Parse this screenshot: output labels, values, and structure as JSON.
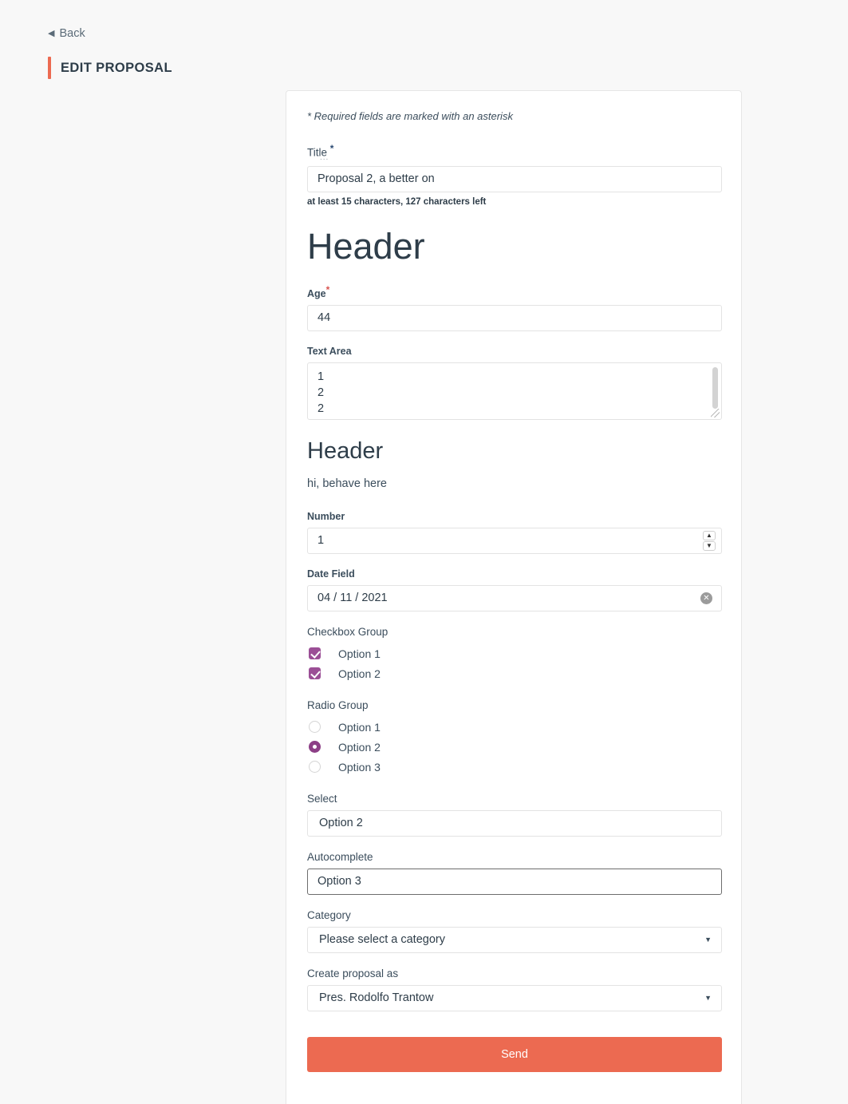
{
  "nav": {
    "back_label": "Back",
    "back_icon": "chevron-left-icon",
    "page_title": "EDIT PROPOSAL",
    "accent_color": "#ec6a51"
  },
  "form": {
    "required_note": "* Required fields are marked with an asterisk",
    "title_field": {
      "label": "Title",
      "asterisk": "*",
      "tooltip_dots": "...",
      "value": "Proposal 2, a better on",
      "helper": "at least 15 characters, 127 characters left"
    },
    "header_1": "Header",
    "age_field": {
      "label": "Age",
      "asterisk": "*",
      "value": "44"
    },
    "textarea_field": {
      "label": "Text Area",
      "line1": "1",
      "line2": "2",
      "line3": "2"
    },
    "header_2": "Header",
    "paragraph": "hi, behave here",
    "number_field": {
      "label": "Number",
      "value": "1",
      "up_icon": "chevron-up-icon",
      "down_icon": "chevron-down-icon"
    },
    "date_field": {
      "label": "Date Field",
      "value": "04 / 11 / 2021",
      "clear_icon": "✕"
    },
    "checkbox_group": {
      "label": "Checkbox Group",
      "accent_color": "#9b4f96",
      "options": [
        {
          "label": "Option 1",
          "checked": true
        },
        {
          "label": "Option 2",
          "checked": true
        }
      ]
    },
    "radio_group": {
      "label": "Radio Group",
      "accent_color": "#8c3f86",
      "options": [
        {
          "label": "Option 1",
          "checked": false
        },
        {
          "label": "Option 2",
          "checked": true
        },
        {
          "label": "Option 3",
          "checked": false
        }
      ]
    },
    "select_field": {
      "label": "Select",
      "value": "Option 2"
    },
    "autocomplete_field": {
      "label": "Autocomplete",
      "value": "Option 3"
    },
    "category_field": {
      "label": "Category",
      "value": "Please select a category",
      "caret_icon": "▼"
    },
    "create_as_field": {
      "label": "Create proposal as",
      "value": "Pres. Rodolfo Trantow",
      "caret_icon": "▼"
    },
    "send_button": "Send"
  }
}
